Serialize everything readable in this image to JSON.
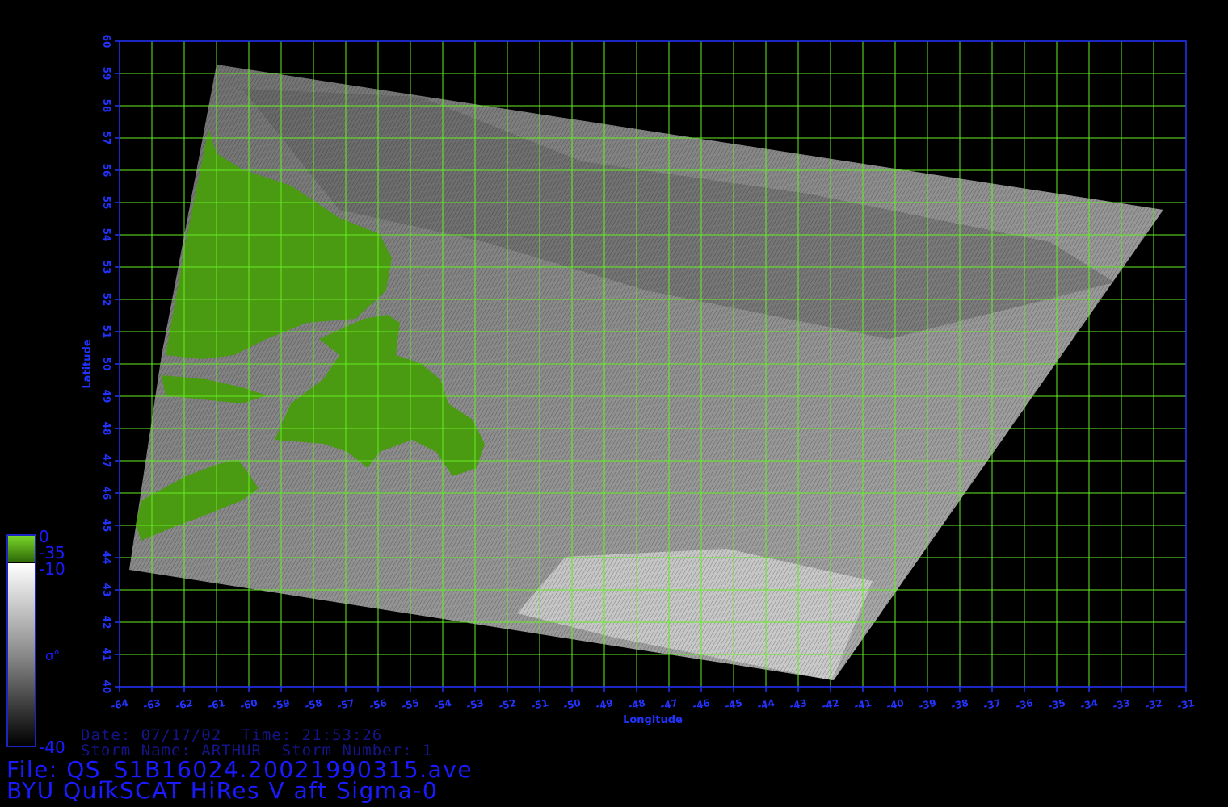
{
  "map": {
    "xlabel": "Longitude",
    "ylabel": "Latitude",
    "lon_range": [
      -64,
      -31
    ],
    "lat_range": [
      40,
      60
    ],
    "lon_ticks": [
      "-64",
      "-63",
      "-62",
      "-61",
      "-60",
      "-59",
      "-58",
      "-57",
      "-56",
      "-55",
      "-54",
      "-53",
      "-52",
      "-51",
      "-50",
      "-49",
      "-48",
      "-47",
      "-46",
      "-45",
      "-44",
      "-43",
      "-42",
      "-41",
      "-40",
      "-39",
      "-38",
      "-37",
      "-36",
      "-35",
      "-34",
      "-33",
      "-32",
      "-31"
    ],
    "lat_ticks": [
      "40",
      "41",
      "42",
      "43",
      "44",
      "45",
      "46",
      "47",
      "48",
      "49",
      "50",
      "51",
      "52",
      "53",
      "54",
      "55",
      "56",
      "57",
      "58",
      "59",
      "60"
    ],
    "grid": true,
    "colors": {
      "grid": "#66ee22",
      "axis": "#2233ff",
      "land": "#4a9a12",
      "background": "#000000"
    }
  },
  "colorbar": {
    "land_top": "0",
    "land_bottom": "-35",
    "max": "-10",
    "min": "-40",
    "symbol": "σ°"
  },
  "info": {
    "date_line": "Date: 07/17/02  Time: 21:53:26",
    "storm_line": "Storm Name: ARTHUR  Storm Number: 1",
    "file_line": "File: QS_S1B16024.20021990315.ave",
    "product_line": "BYU QuikSCAT HiRes V aft Sigma-0"
  }
}
